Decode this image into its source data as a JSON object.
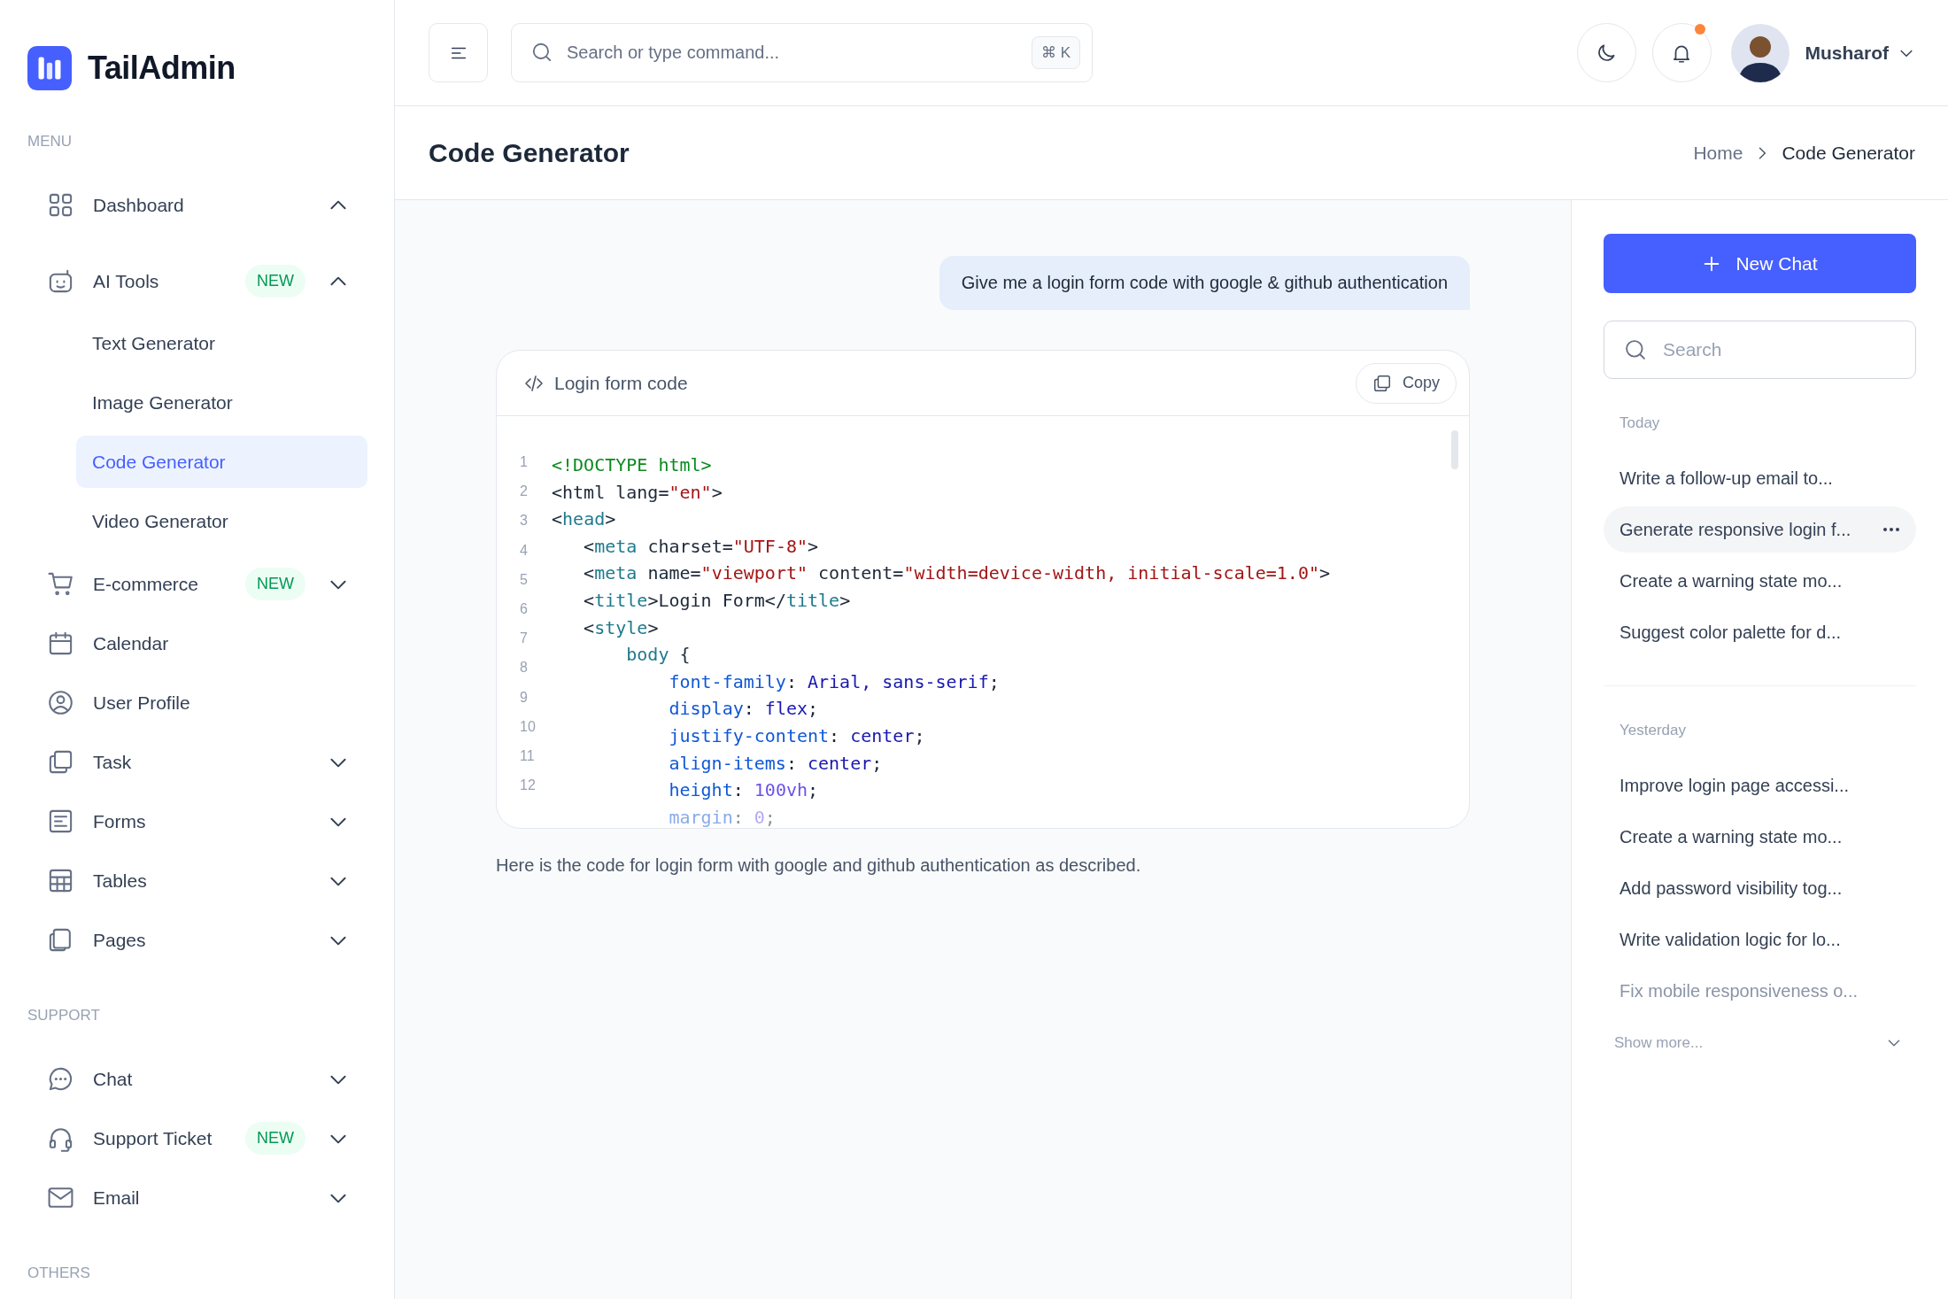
{
  "brand": {
    "name": "TailAdmin"
  },
  "sidebar": {
    "sections": [
      {
        "title": "MENU",
        "items": [
          {
            "label": "Dashboard",
            "kind": "group",
            "expanded": true
          },
          {
            "label": "AI Tools",
            "kind": "group",
            "expanded": true,
            "badge": "NEW",
            "children": [
              {
                "label": "Text Generator",
                "selected": false
              },
              {
                "label": "Image Generator",
                "selected": false
              },
              {
                "label": "Code Generator",
                "selected": true
              },
              {
                "label": "Video Generator",
                "selected": false
              }
            ]
          },
          {
            "label": "E-commerce",
            "kind": "group",
            "expanded": false,
            "badge": "NEW"
          },
          {
            "label": "Calendar",
            "kind": "link"
          },
          {
            "label": "User Profile",
            "kind": "link"
          },
          {
            "label": "Task",
            "kind": "group",
            "expanded": false
          },
          {
            "label": "Forms",
            "kind": "group",
            "expanded": false
          },
          {
            "label": "Tables",
            "kind": "group",
            "expanded": false
          },
          {
            "label": "Pages",
            "kind": "group",
            "expanded": false
          }
        ]
      },
      {
        "title": "SUPPORT",
        "items": [
          {
            "label": "Chat",
            "kind": "group",
            "expanded": false
          },
          {
            "label": "Support Ticket",
            "kind": "group",
            "expanded": false,
            "badge": "NEW"
          },
          {
            "label": "Email",
            "kind": "group",
            "expanded": false
          }
        ]
      },
      {
        "title": "OTHERS"
      }
    ]
  },
  "header": {
    "search": {
      "placeholder": "Search or type command...",
      "shortcut": "⌘ K"
    },
    "notifications_unread": true,
    "user": {
      "name": "Musharof"
    }
  },
  "page": {
    "title": "Code Generator",
    "breadcrumb": [
      "Home",
      "Code Generator"
    ]
  },
  "chat": {
    "prompt": "Give me a login form code with google & github authentication",
    "code_card": {
      "title": "Login form code",
      "copy_label": "Copy",
      "line_numbers": [
        "1",
        "2",
        "3",
        "4",
        "5",
        "6",
        "7",
        "8",
        "9",
        "10",
        "11",
        "12"
      ],
      "lines": [
        {
          "faded": false,
          "tokens": [
            {
              "kind": "doctype",
              "text": "<!DOCTYPE html>"
            }
          ]
        },
        {
          "faded": false,
          "tokens": [
            {
              "kind": "punct",
              "text": "<html lang="
            },
            {
              "kind": "string",
              "text": "\"en\""
            },
            {
              "kind": "punct",
              "text": ">"
            }
          ]
        },
        {
          "faded": false,
          "tokens": [
            {
              "kind": "punct",
              "text": "<"
            },
            {
              "kind": "tag",
              "text": "head"
            },
            {
              "kind": "punct",
              "text": ">"
            }
          ]
        },
        {
          "faded": false,
          "tokens": [
            {
              "kind": "punct",
              "text": "   <"
            },
            {
              "kind": "tag",
              "text": "meta"
            },
            {
              "kind": "punct",
              "text": " charset="
            },
            {
              "kind": "string",
              "text": "\"UTF-8\""
            },
            {
              "kind": "punct",
              "text": ">"
            }
          ]
        },
        {
          "faded": false,
          "tokens": [
            {
              "kind": "punct",
              "text": "   <"
            },
            {
              "kind": "tag",
              "text": "meta"
            },
            {
              "kind": "punct",
              "text": " name="
            },
            {
              "kind": "string",
              "text": "\"viewport\""
            },
            {
              "kind": "punct",
              "text": " content="
            },
            {
              "kind": "string",
              "text": "\"width=device-width, initial-scale=1.0\""
            },
            {
              "kind": "punct",
              "text": ">"
            }
          ]
        },
        {
          "faded": false,
          "tokens": [
            {
              "kind": "punct",
              "text": "   <"
            },
            {
              "kind": "tag",
              "text": "title"
            },
            {
              "kind": "punct",
              "text": ">Login Form</"
            },
            {
              "kind": "tag",
              "text": "title"
            },
            {
              "kind": "punct",
              "text": ">"
            }
          ]
        },
        {
          "faded": false,
          "tokens": [
            {
              "kind": "punct",
              "text": "   <"
            },
            {
              "kind": "tag",
              "text": "style"
            },
            {
              "kind": "punct",
              "text": ">"
            }
          ]
        },
        {
          "faded": false,
          "tokens": [
            {
              "kind": "tag",
              "text": "       body"
            },
            {
              "kind": "punct",
              "text": " {"
            }
          ]
        },
        {
          "faded": false,
          "tokens": [
            {
              "kind": "prop",
              "text": "           font-family"
            },
            {
              "kind": "punct",
              "text": ": "
            },
            {
              "kind": "value",
              "text": "Arial, sans-serif"
            },
            {
              "kind": "punct",
              "text": ";"
            }
          ]
        },
        {
          "faded": false,
          "tokens": [
            {
              "kind": "prop",
              "text": "           display"
            },
            {
              "kind": "punct",
              "text": ": "
            },
            {
              "kind": "value",
              "text": "flex"
            },
            {
              "kind": "punct",
              "text": ";"
            }
          ]
        },
        {
          "faded": false,
          "tokens": [
            {
              "kind": "prop",
              "text": "           justify-content"
            },
            {
              "kind": "punct",
              "text": ": "
            },
            {
              "kind": "value",
              "text": "center"
            },
            {
              "kind": "punct",
              "text": ";"
            }
          ]
        },
        {
          "faded": false,
          "tokens": [
            {
              "kind": "prop",
              "text": "           align-items"
            },
            {
              "kind": "punct",
              "text": ": "
            },
            {
              "kind": "value",
              "text": "center"
            },
            {
              "kind": "punct",
              "text": ";"
            }
          ]
        },
        {
          "faded": false,
          "tokens": [
            {
              "kind": "prop",
              "text": "           height"
            },
            {
              "kind": "punct",
              "text": ": "
            },
            {
              "kind": "number",
              "text": "100vh"
            },
            {
              "kind": "punct",
              "text": ";"
            }
          ]
        },
        {
          "faded": true,
          "tokens": [
            {
              "kind": "prop",
              "text": "           margin"
            },
            {
              "kind": "punct",
              "text": ": "
            },
            {
              "kind": "number",
              "text": "0"
            },
            {
              "kind": "punct",
              "text": ";"
            }
          ]
        }
      ]
    },
    "reply": "Here is the code for login form with google and github authentication as described."
  },
  "history": {
    "new_chat_label": "New Chat",
    "search_placeholder": "Search",
    "groups": [
      {
        "title": "Today",
        "items": [
          {
            "label": "Write a follow-up email to...",
            "selected": false,
            "faded": false
          },
          {
            "label": "Generate responsive login f...",
            "selected": true,
            "faded": false
          },
          {
            "label": "Create a warning state mo...",
            "selected": false,
            "faded": false
          },
          {
            "label": "Suggest color palette for d...",
            "selected": false,
            "faded": false
          }
        ]
      },
      {
        "title": "Yesterday",
        "items": [
          {
            "label": "Improve login page accessi...",
            "selected": false,
            "faded": false
          },
          {
            "label": "Create a warning state mo...",
            "selected": false,
            "faded": false
          },
          {
            "label": "Add password visibility tog...",
            "selected": false,
            "faded": false
          },
          {
            "label": "Write validation logic for lo...",
            "selected": false,
            "faded": false
          },
          {
            "label": "Fix mobile responsiveness o...",
            "selected": false,
            "faded": true
          }
        ]
      }
    ],
    "show_more": "Show more..."
  }
}
